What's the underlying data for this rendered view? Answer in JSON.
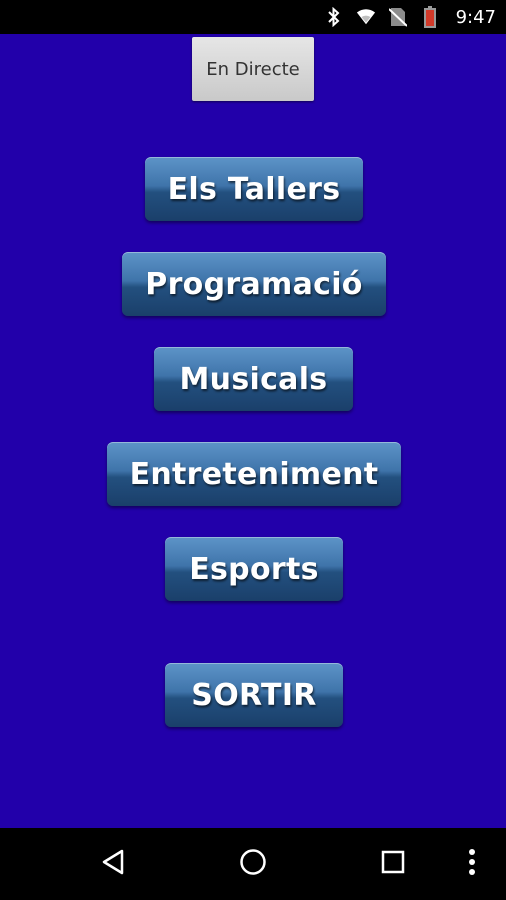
{
  "status_bar": {
    "time": "9:47",
    "icons": [
      "bluetooth-icon",
      "wifi-icon",
      "no-sim-icon",
      "battery-low-icon"
    ]
  },
  "app": {
    "background_color": "#2200aa",
    "live_button_label": "En Directe",
    "menu": [
      {
        "id": "tallers",
        "label": "Els Tallers"
      },
      {
        "id": "programacio",
        "label": "Programació"
      },
      {
        "id": "musicals",
        "label": "Musicals"
      },
      {
        "id": "entreteniment",
        "label": "Entreteniment"
      },
      {
        "id": "esports",
        "label": "Esports"
      },
      {
        "id": "sortir",
        "label": "SORTIR"
      }
    ]
  },
  "nav_bar": {
    "icons": [
      "back-icon",
      "home-icon",
      "recents-icon",
      "overflow-menu-icon"
    ]
  }
}
